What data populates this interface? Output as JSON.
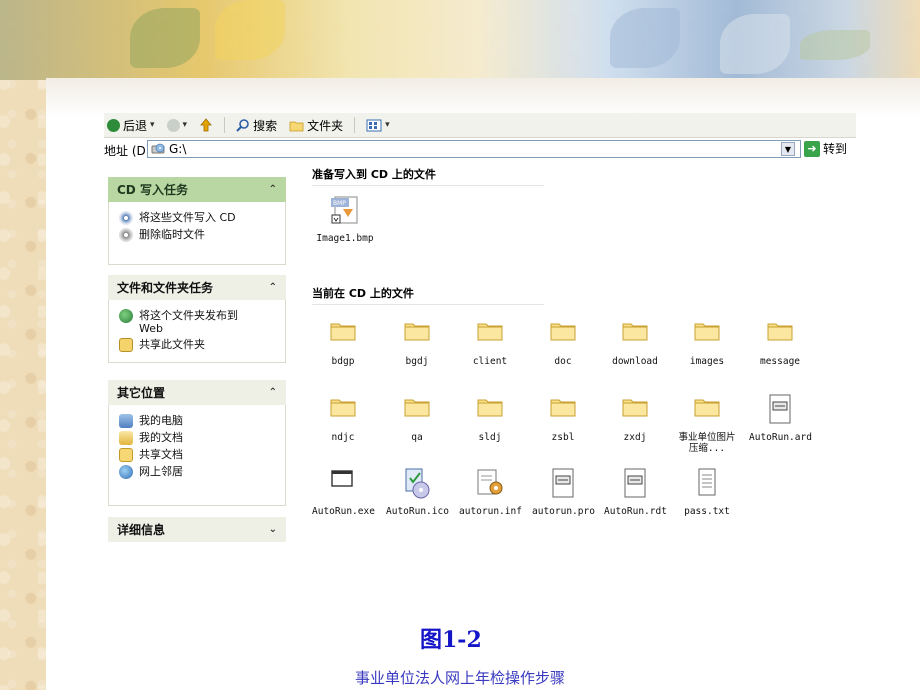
{
  "toolbar": {
    "back_label": "后退",
    "search_label": "搜索",
    "folders_label": "文件夹"
  },
  "address": {
    "label": "地址 (D)",
    "value": "G:\\",
    "go_label": "转到"
  },
  "panels": {
    "cd_tasks": {
      "title": "CD 写入任务",
      "items": [
        {
          "label": "将这些文件写入 CD",
          "icon": "cd-burn-icon"
        },
        {
          "label": "删除临时文件",
          "icon": "delete-temp-icon"
        }
      ]
    },
    "file_tasks": {
      "title": "文件和文件夹任务",
      "items": [
        {
          "label": "将这个文件夹发布到 Web",
          "icon": "web-publish-icon"
        },
        {
          "label": "共享此文件夹",
          "icon": "share-folder-icon"
        }
      ]
    },
    "other_places": {
      "title": "其它位置",
      "items": [
        {
          "label": "我的电脑",
          "icon": "my-computer-icon"
        },
        {
          "label": "我的文档",
          "icon": "my-documents-icon"
        },
        {
          "label": "共享文档",
          "icon": "shared-documents-icon"
        },
        {
          "label": "网上邻居",
          "icon": "network-icon"
        }
      ]
    },
    "details": {
      "title": "详细信息"
    }
  },
  "sections": {
    "ready_title": "准备写入到 CD 上的文件",
    "current_title": "当前在 CD 上的文件"
  },
  "ready_files": [
    {
      "name": "Image1.bmp",
      "icon": "bmp-file-icon"
    }
  ],
  "current_files": [
    {
      "name": "bdgp",
      "icon": "folder-icon"
    },
    {
      "name": "bgdj",
      "icon": "folder-icon"
    },
    {
      "name": "client",
      "icon": "folder-icon"
    },
    {
      "name": "doc",
      "icon": "folder-icon"
    },
    {
      "name": "download",
      "icon": "folder-icon"
    },
    {
      "name": "images",
      "icon": "folder-icon"
    },
    {
      "name": "message",
      "icon": "folder-icon"
    },
    {
      "name": "ndjc",
      "icon": "folder-icon"
    },
    {
      "name": "qa",
      "icon": "folder-icon"
    },
    {
      "name": "sldj",
      "icon": "folder-icon"
    },
    {
      "name": "zsbl",
      "icon": "folder-icon"
    },
    {
      "name": "zxdj",
      "icon": "folder-icon"
    },
    {
      "name": "事业单位图片压缩...",
      "icon": "folder-icon"
    },
    {
      "name": "AutoRun.ard",
      "icon": "ard-file-icon"
    },
    {
      "name": "AutoRun.exe",
      "icon": "exe-file-icon"
    },
    {
      "name": "AutoRun.ico",
      "icon": "ico-file-icon"
    },
    {
      "name": "autorun.inf",
      "icon": "inf-file-icon"
    },
    {
      "name": "autorun.pro",
      "icon": "pro-file-icon"
    },
    {
      "name": "AutoRun.rdt",
      "icon": "rdt-file-icon"
    },
    {
      "name": "pass.txt",
      "icon": "txt-file-icon"
    }
  ],
  "caption": "图1-2",
  "footer": "事业单位法人网上年检操作步骤"
}
